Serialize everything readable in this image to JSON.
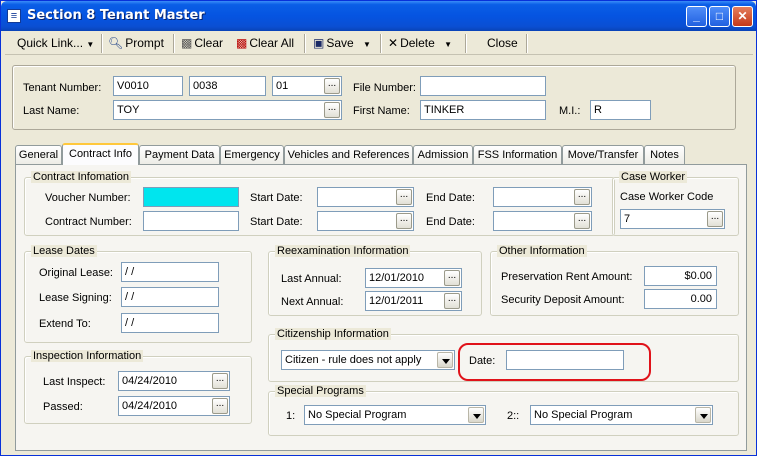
{
  "window": {
    "title": "Section 8 Tenant Master",
    "title_icon": "document-icon"
  },
  "toolbar": {
    "quick_link": "Quick Link...",
    "prompt": "Prompt",
    "clear": "Clear",
    "clear_all": "Clear All",
    "save": "Save",
    "delete": "Delete",
    "close": "Close"
  },
  "header": {
    "tenant_number_label": "Tenant Number:",
    "tenant_number_1": "V0010",
    "tenant_number_2": "0038",
    "tenant_number_3": "01",
    "file_number_label": "File Number:",
    "file_number": "",
    "last_name_label": "Last Name:",
    "last_name": "TOY",
    "first_name_label": "First Name:",
    "first_name": "TINKER",
    "mi_label": "M.I.:",
    "mi": "R"
  },
  "tabs": [
    "General",
    "Contract Info",
    "Payment Data",
    "Emergency",
    "Vehicles and References",
    "Admission",
    "FSS Information",
    "Move/Transfer",
    "Notes"
  ],
  "active_tab": "Contract Info",
  "contract": {
    "legend": "Contract Infomation",
    "voucher_label": "Voucher Number:",
    "voucher_value": "",
    "contract_label": "Contract Number:",
    "contract_value": "",
    "start_label": "Start Date:",
    "end_label": "End Date:",
    "start1": "",
    "end1": "",
    "start2": "",
    "end2": ""
  },
  "case_worker": {
    "legend": "Case Worker",
    "code_label": "Case Worker Code",
    "code": "7"
  },
  "lease": {
    "legend": "Lease Dates",
    "original_label": "Original Lease:",
    "original": "/ /",
    "signing_label": "Lease Signing:",
    "signing": "/ /",
    "extend_label": "Extend To:",
    "extend": "/ /"
  },
  "reexam": {
    "legend": "Reexamination Information",
    "last_label": "Last Annual:",
    "last": "12/01/2010",
    "next_label": "Next Annual:",
    "next": "12/01/2011"
  },
  "other": {
    "legend": "Other Information",
    "pres_label": "Preservation Rent Amount:",
    "pres": "$0.00",
    "sec_label": "Security Deposit Amount:",
    "sec": "0.00"
  },
  "citizenship": {
    "legend": "Citizenship Information",
    "status": "Citizen - rule does not apply",
    "date_label": "Date:",
    "date": ""
  },
  "inspection": {
    "legend": "Inspection Information",
    "last_label": "Last Inspect:",
    "last": "04/24/2010",
    "passed_label": "Passed:",
    "passed": "04/24/2010"
  },
  "special": {
    "legend": "Special Programs",
    "p1_label": "1:",
    "p1": "No Special Program",
    "p2_label": "2::",
    "p2": "No Special Program"
  },
  "ellipsis": "...",
  "colors": {
    "title_bar": "#0a5ee6",
    "highlight_field": "#00e5ee",
    "annotation": "#e0121a",
    "tab_active_accent": "#ffc83c"
  }
}
